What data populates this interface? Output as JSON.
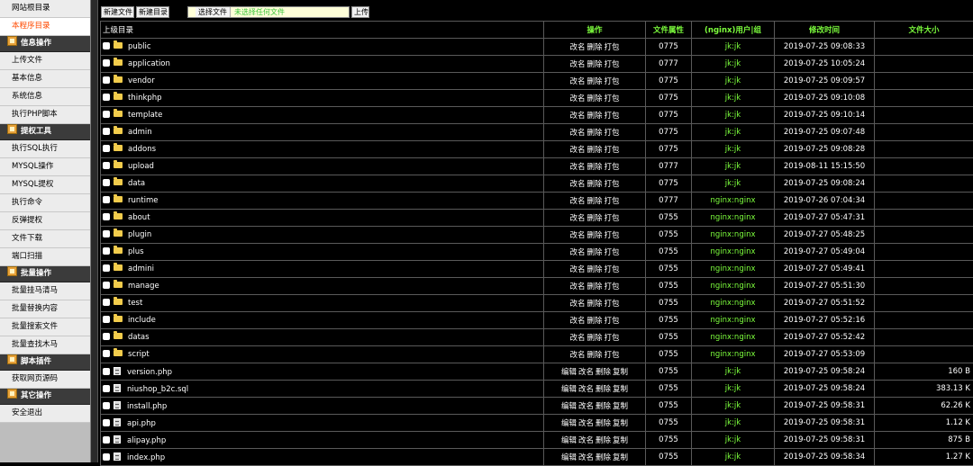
{
  "sidebar": {
    "sections": [
      {
        "heading": "",
        "items": [
          "网站根目录",
          "本程序目录"
        ]
      },
      {
        "heading": "信息操作",
        "items": [
          "上传文件",
          "基本信息",
          "系统信息",
          "执行PHP脚本"
        ]
      },
      {
        "heading": "提权工具",
        "items": [
          "执行SQL执行",
          "MYSQL操作",
          "MYSQL提权",
          "执行命令",
          "反弹提权",
          "文件下载",
          "端口扫描"
        ]
      },
      {
        "heading": "批量操作",
        "items": [
          "批量挂马清马",
          "批量替换内容",
          "批量搜索文件",
          "批量查找木马"
        ]
      },
      {
        "heading": "脚本插件",
        "items": [
          "获取网页源码"
        ]
      },
      {
        "heading": "其它操作",
        "items": [
          "安全退出"
        ]
      }
    ],
    "active_item": "本程序目录"
  },
  "toolbar": {
    "new_file": "新建文件",
    "new_dir": "新建目录",
    "choose_file": "选择文件",
    "no_file": "未选择任何文件",
    "upload": "上传"
  },
  "table": {
    "headers": {
      "parent": "上级目录",
      "ops": "操作",
      "perm": "文件属性",
      "owner": "(nginx)用户|组",
      "mtime": "修改时间",
      "size": "文件大小"
    },
    "folder_ops": [
      "改名",
      "删除",
      "打包"
    ],
    "file_ops": [
      "编辑",
      "改名",
      "删除",
      "复制"
    ],
    "rows": [
      {
        "type": "folder",
        "name": "public",
        "perm": "0775",
        "owner": "jk:jk",
        "mtime": "2019-07-25 09:08:33",
        "size": ""
      },
      {
        "type": "folder",
        "name": "application",
        "perm": "0777",
        "owner": "jk:jk",
        "mtime": "2019-07-25 10:05:24",
        "size": ""
      },
      {
        "type": "folder",
        "name": "vendor",
        "perm": "0775",
        "owner": "jk:jk",
        "mtime": "2019-07-25 09:09:57",
        "size": ""
      },
      {
        "type": "folder",
        "name": "thinkphp",
        "perm": "0775",
        "owner": "jk:jk",
        "mtime": "2019-07-25 09:10:08",
        "size": ""
      },
      {
        "type": "folder",
        "name": "template",
        "perm": "0775",
        "owner": "jk:jk",
        "mtime": "2019-07-25 09:10:14",
        "size": ""
      },
      {
        "type": "folder",
        "name": "admin",
        "perm": "0775",
        "owner": "jk:jk",
        "mtime": "2019-07-25 09:07:48",
        "size": ""
      },
      {
        "type": "folder",
        "name": "addons",
        "perm": "0775",
        "owner": "jk:jk",
        "mtime": "2019-07-25 09:08:28",
        "size": ""
      },
      {
        "type": "folder",
        "name": "upload",
        "perm": "0777",
        "owner": "jk:jk",
        "mtime": "2019-08-11 15:15:50",
        "size": ""
      },
      {
        "type": "folder",
        "name": "data",
        "perm": "0775",
        "owner": "jk:jk",
        "mtime": "2019-07-25 09:08:24",
        "size": ""
      },
      {
        "type": "folder",
        "name": "runtime",
        "perm": "0777",
        "owner": "nginx:nginx",
        "mtime": "2019-07-26 07:04:34",
        "size": ""
      },
      {
        "type": "folder",
        "name": "about",
        "perm": "0755",
        "owner": "nginx:nginx",
        "mtime": "2019-07-27 05:47:31",
        "size": ""
      },
      {
        "type": "folder",
        "name": "plugin",
        "perm": "0755",
        "owner": "nginx:nginx",
        "mtime": "2019-07-27 05:48:25",
        "size": ""
      },
      {
        "type": "folder",
        "name": "plus",
        "perm": "0755",
        "owner": "nginx:nginx",
        "mtime": "2019-07-27 05:49:04",
        "size": ""
      },
      {
        "type": "folder",
        "name": "admini",
        "perm": "0755",
        "owner": "nginx:nginx",
        "mtime": "2019-07-27 05:49:41",
        "size": ""
      },
      {
        "type": "folder",
        "name": "manage",
        "perm": "0755",
        "owner": "nginx:nginx",
        "mtime": "2019-07-27 05:51:30",
        "size": ""
      },
      {
        "type": "folder",
        "name": "test",
        "perm": "0755",
        "owner": "nginx:nginx",
        "mtime": "2019-07-27 05:51:52",
        "size": ""
      },
      {
        "type": "folder",
        "name": "include",
        "perm": "0755",
        "owner": "nginx:nginx",
        "mtime": "2019-07-27 05:52:16",
        "size": ""
      },
      {
        "type": "folder",
        "name": "datas",
        "perm": "0755",
        "owner": "nginx:nginx",
        "mtime": "2019-07-27 05:52:42",
        "size": ""
      },
      {
        "type": "folder",
        "name": "script",
        "perm": "0755",
        "owner": "nginx:nginx",
        "mtime": "2019-07-27 05:53:09",
        "size": ""
      },
      {
        "type": "file",
        "name": "version.php",
        "perm": "0755",
        "owner": "jk:jk",
        "mtime": "2019-07-25 09:58:24",
        "size": "160 B"
      },
      {
        "type": "file",
        "name": "niushop_b2c.sql",
        "perm": "0755",
        "owner": "jk:jk",
        "mtime": "2019-07-25 09:58:24",
        "size": "383.13 K"
      },
      {
        "type": "file",
        "name": "install.php",
        "perm": "0755",
        "owner": "jk:jk",
        "mtime": "2019-07-25 09:58:31",
        "size": "62.26 K"
      },
      {
        "type": "file",
        "name": "api.php",
        "perm": "0755",
        "owner": "jk:jk",
        "mtime": "2019-07-25 09:58:31",
        "size": "1.12 K"
      },
      {
        "type": "file",
        "name": "alipay.php",
        "perm": "0755",
        "owner": "jk:jk",
        "mtime": "2019-07-25 09:58:31",
        "size": "875 B"
      },
      {
        "type": "file",
        "name": "index.php",
        "perm": "0755",
        "owner": "jk:jk",
        "mtime": "2019-07-25 09:58:34",
        "size": "1.27 K"
      }
    ]
  }
}
